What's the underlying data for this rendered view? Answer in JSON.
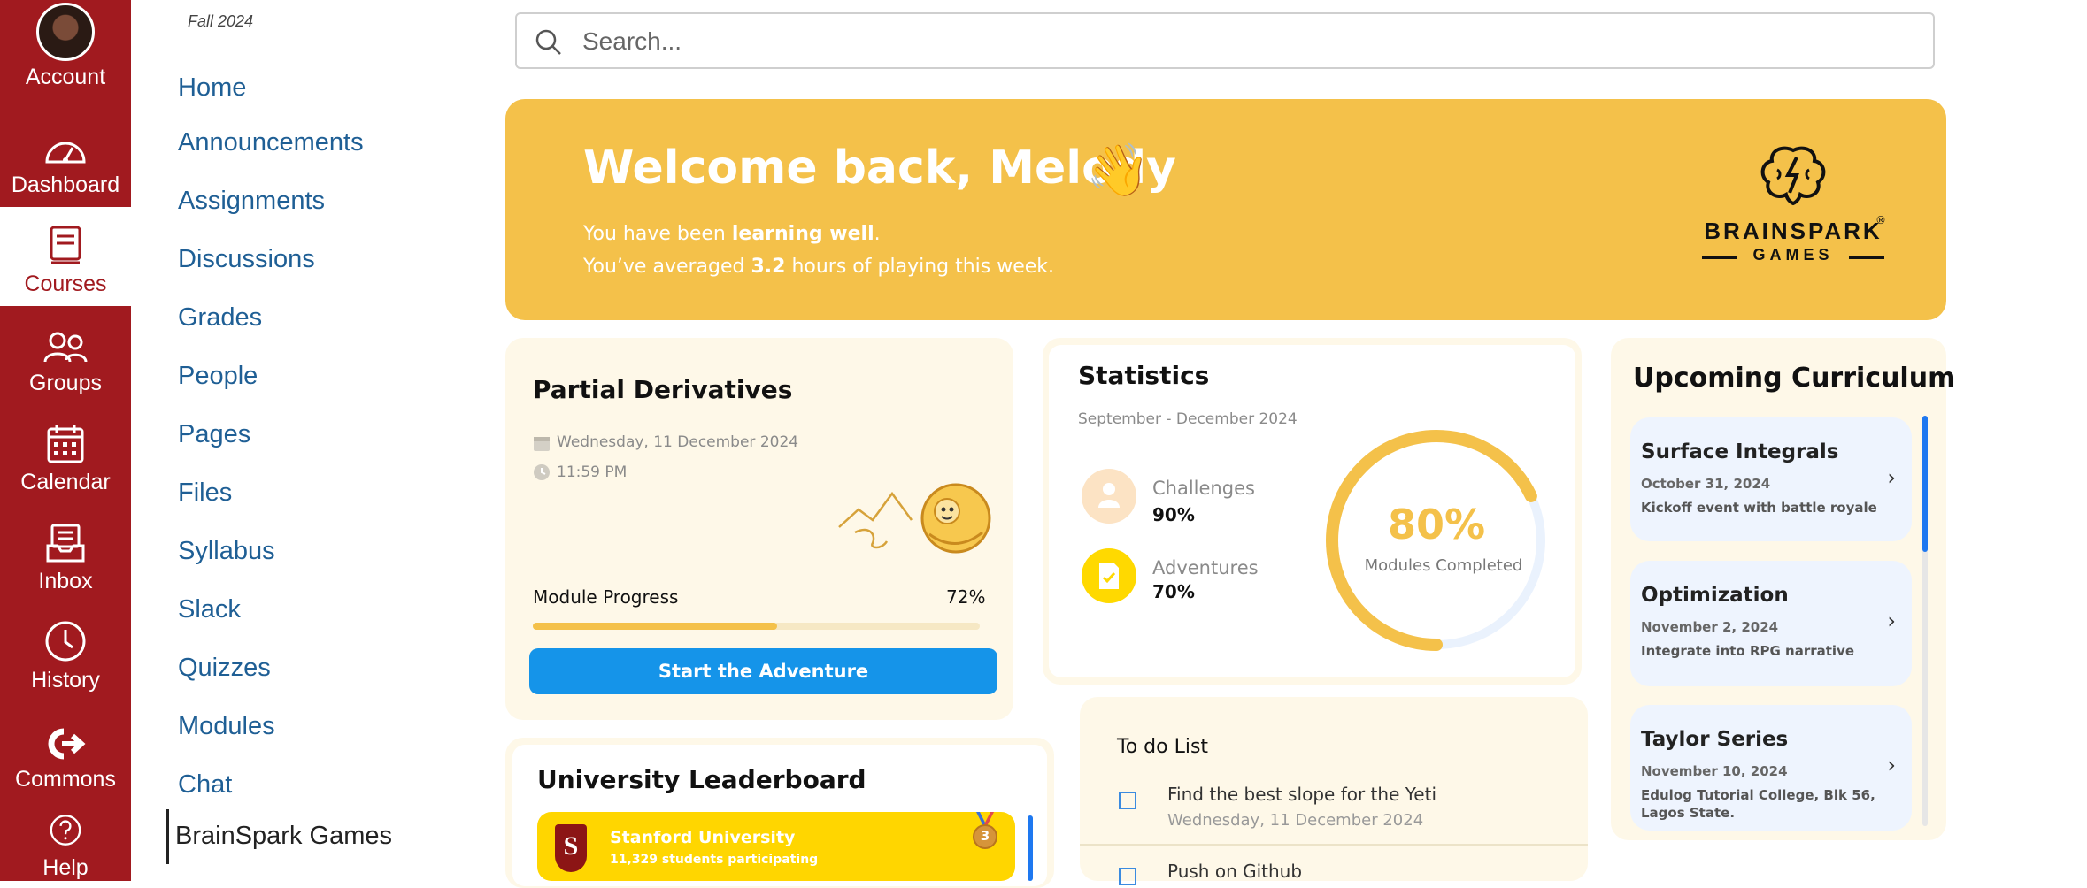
{
  "global_nav": {
    "items": [
      {
        "label": "Account",
        "icon": "avatar"
      },
      {
        "label": "Dashboard",
        "icon": "dashboard-icon"
      },
      {
        "label": "Courses",
        "icon": "courses-icon"
      },
      {
        "label": "Groups",
        "icon": "groups-icon"
      },
      {
        "label": "Calendar",
        "icon": "calendar-icon"
      },
      {
        "label": "Inbox",
        "icon": "inbox-icon"
      },
      {
        "label": "History",
        "icon": "history-icon"
      },
      {
        "label": "Commons",
        "icon": "commons-icon"
      },
      {
        "label": "Help",
        "icon": "help-icon"
      }
    ],
    "active": "Courses",
    "color": "#a11a1f"
  },
  "course_nav": {
    "term": "Fall 2024",
    "links": [
      "Home",
      "Announcements",
      "Assignments",
      "Discussions",
      "Grades",
      "People",
      "Pages",
      "Files",
      "Syllabus",
      "Slack",
      "Quizzes",
      "Modules",
      "Chat",
      "BrainSpark Games"
    ],
    "active": "BrainSpark Games"
  },
  "search": {
    "placeholder": "Search..."
  },
  "hero": {
    "title": "Welcome back, Melody",
    "wave": "👋",
    "line1_prefix": "You have been ",
    "line1_bold": "learning well",
    "line1_suffix": ".",
    "line2_prefix": "You’ve averaged ",
    "line2_bold": "3.2",
    "line2_suffix": " hours of playing this week.",
    "brand_name": "BRAINSPARK",
    "brand_sub": "GAMES",
    "brand_reg": "®",
    "color": "#f4c14a"
  },
  "assignment": {
    "title": "Partial Derivatives",
    "date": "Wednesday, 11 December 2024",
    "time": "11:59 PM",
    "progress_label": "Module Progress",
    "progress_value": "72%",
    "progress_fraction": 0.72,
    "button": "Start the Adventure"
  },
  "statistics": {
    "title": "Statistics",
    "range": "September - December 2024",
    "challenges_label": "Challenges",
    "challenges_value": "90%",
    "adventures_label": "Adventures",
    "adventures_value": "70%",
    "completed_value": "80%",
    "completed_label": "Modules Completed",
    "completed_fraction": 0.8
  },
  "curriculum": {
    "title": "Upcoming Curriculum",
    "items": [
      {
        "title": "Surface Integrals",
        "date": "October 31, 2024",
        "desc": "Kickoff event with battle royale"
      },
      {
        "title": "Optimization",
        "date": "November 2, 2024",
        "desc": "Integrate into RPG narrative"
      },
      {
        "title": "Taylor Series",
        "date": "November 10, 2024",
        "desc": "Edulog Tutorial College, Blk 56, Lagos State."
      }
    ]
  },
  "todo": {
    "title": "To do List",
    "items": [
      {
        "title": "Find the best slope for the Yeti",
        "date": "Wednesday, 11 December 2024"
      },
      {
        "title": "Push on Github",
        "date": ""
      }
    ]
  },
  "leaderboard": {
    "title": "University Leaderboard",
    "entries": [
      {
        "name": "Stanford University",
        "sub": "11,329 students participating",
        "logo_letter": "S",
        "medal": "3"
      }
    ]
  }
}
